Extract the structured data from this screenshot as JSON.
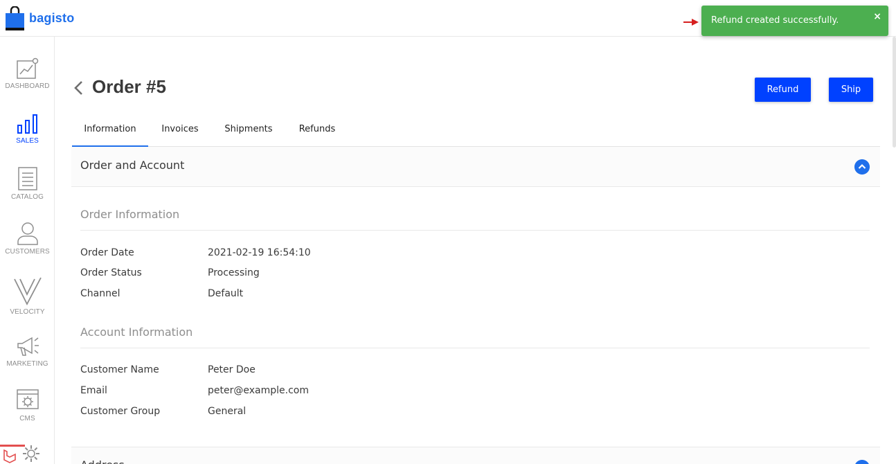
{
  "app": {
    "logo_text": "bagisto",
    "brand_color": "#1f6feb"
  },
  "sidebar": {
    "items": [
      {
        "label": "DASHBOARD",
        "icon": "dashboard-icon"
      },
      {
        "label": "SALES",
        "icon": "sales-chart-icon",
        "active": true
      },
      {
        "label": "CATALOG",
        "icon": "catalog-icon"
      },
      {
        "label": "CUSTOMERS",
        "icon": "customers-icon"
      },
      {
        "label": "VELOCITY",
        "icon": "velocity-icon"
      },
      {
        "label": "MARKETING",
        "icon": "marketing-megaphone-icon"
      },
      {
        "label": "CMS",
        "icon": "cms-icon"
      },
      {
        "label": "",
        "icon": "settings-gear-icon"
      }
    ]
  },
  "page": {
    "title": "Order #5",
    "refund_label": "Refund",
    "ship_label": "Ship",
    "accent": "#0041ff"
  },
  "tabs": [
    {
      "label": "Information",
      "active": true
    },
    {
      "label": "Invoices"
    },
    {
      "label": "Shipments"
    },
    {
      "label": "Refunds"
    }
  ],
  "order_account": {
    "title": "Order and Account",
    "order_info": {
      "title": "Order Information",
      "rows": [
        {
          "label": "Order Date",
          "value": "2021-02-19 16:54:10"
        },
        {
          "label": "Order Status",
          "value": "Processing"
        },
        {
          "label": "Channel",
          "value": "Default"
        }
      ]
    },
    "account_info": {
      "title": "Account Information",
      "rows": [
        {
          "label": "Customer Name",
          "value": "Peter Doe"
        },
        {
          "label": "Email",
          "value": "peter@example.com"
        },
        {
          "label": "Customer Group",
          "value": "General"
        }
      ]
    }
  },
  "address": {
    "title": "Address"
  },
  "toast": {
    "message": "Refund created successfully.",
    "close": "×",
    "color": "#4caf50"
  }
}
